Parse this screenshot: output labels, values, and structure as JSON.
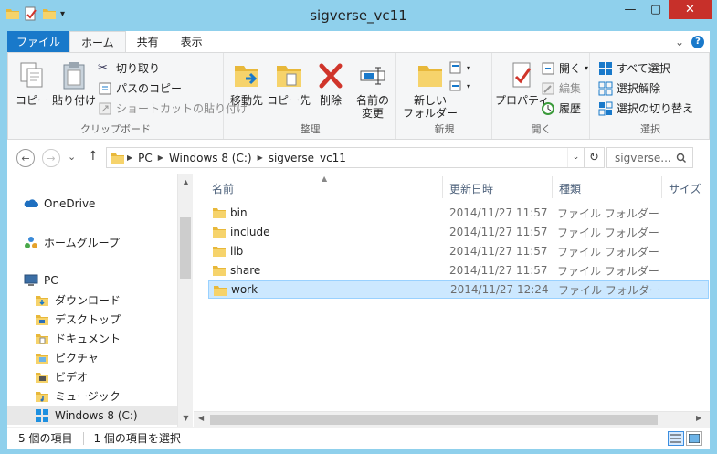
{
  "window": {
    "title": "sigverse_vc11",
    "minimize": "—",
    "maximize": "▢",
    "close": "✕"
  },
  "ribbon_tabs": {
    "file": "ファイル",
    "home": "ホーム",
    "share": "共有",
    "view": "表示",
    "collapse": "⌄",
    "help": "?"
  },
  "ribbon": {
    "clipboard": {
      "label": "クリップボード",
      "copy": "コピー",
      "paste": "貼り付け",
      "cut": "切り取り",
      "copy_path": "パスのコピー",
      "paste_shortcut": "ショートカットの貼り付け"
    },
    "organize": {
      "label": "整理",
      "move_to": "移動先",
      "copy_to": "コピー先",
      "delete": "削除",
      "rename_line1": "名前の",
      "rename_line2": "変更"
    },
    "new": {
      "label": "新規",
      "new_folder_line1": "新しい",
      "new_folder_line2": "フォルダー"
    },
    "open": {
      "label": "開く",
      "properties": "プロパティ",
      "open": "開く",
      "edit": "編集",
      "history": "履歴"
    },
    "select": {
      "label": "選択",
      "select_all": "すべて選択",
      "select_none": "選択解除",
      "invert": "選択の切り替え"
    }
  },
  "address": {
    "back": "←",
    "forward": "→",
    "recent": "⌄",
    "up": "↑",
    "crumbs": [
      "PC",
      "Windows 8 (C:)",
      "sigverse_vc11"
    ],
    "dropdown": "⌄",
    "refresh": "↻",
    "search_placeholder": "sigverse..."
  },
  "nav": {
    "items": [
      {
        "label": "OneDrive"
      },
      {
        "label": "ホームグループ"
      },
      {
        "label": "PC"
      },
      {
        "label": "ダウンロード"
      },
      {
        "label": "デスクトップ"
      },
      {
        "label": "ドキュメント"
      },
      {
        "label": "ピクチャ"
      },
      {
        "label": "ビデオ"
      },
      {
        "label": "ミュージック"
      },
      {
        "label": "Windows 8 (C:)"
      }
    ]
  },
  "files": {
    "columns": {
      "name": "名前",
      "modified": "更新日時",
      "type": "種類",
      "size": "サイズ"
    },
    "rows": [
      {
        "name": "bin",
        "modified": "2014/11/27 11:57",
        "type": "ファイル フォルダー"
      },
      {
        "name": "include",
        "modified": "2014/11/27 11:57",
        "type": "ファイル フォルダー"
      },
      {
        "name": "lib",
        "modified": "2014/11/27 11:57",
        "type": "ファイル フォルダー"
      },
      {
        "name": "share",
        "modified": "2014/11/27 11:57",
        "type": "ファイル フォルダー"
      },
      {
        "name": "work",
        "modified": "2014/11/27 12:24",
        "type": "ファイル フォルダー"
      }
    ]
  },
  "status": {
    "count": "5 個の項目",
    "selected": "1 個の項目を選択"
  }
}
